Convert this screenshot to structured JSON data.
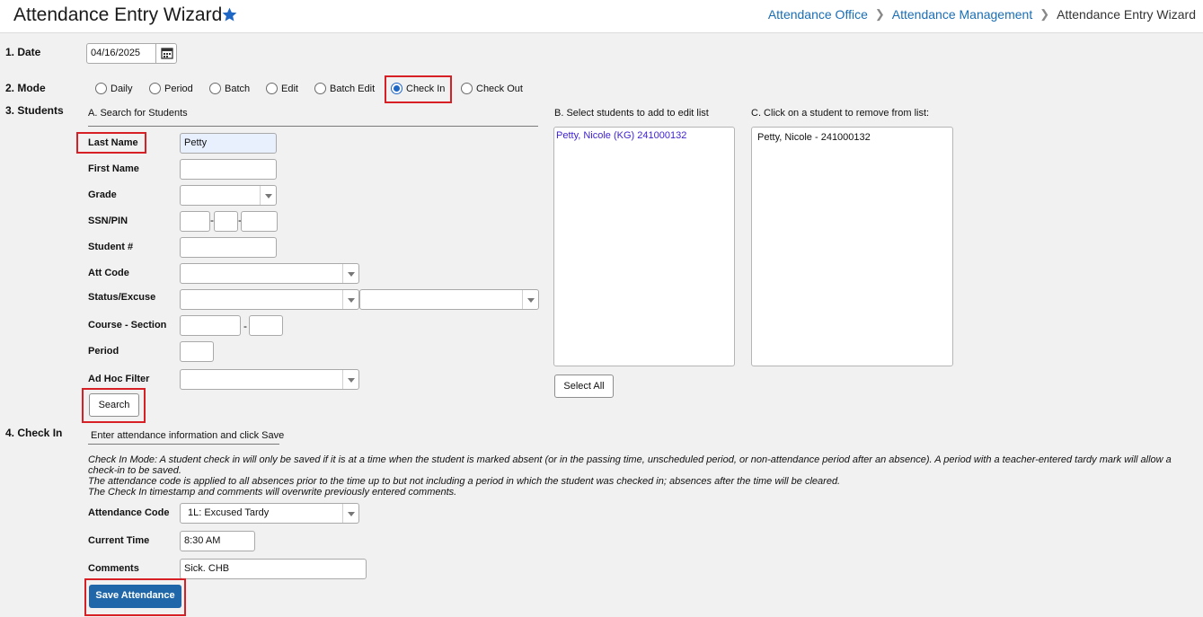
{
  "header": {
    "title": "Attendance Entry Wizard",
    "breadcrumb": [
      "Attendance Office",
      "Attendance Management",
      "Attendance Entry Wizard"
    ]
  },
  "date": {
    "label": "1. Date",
    "value": "04/16/2025"
  },
  "mode": {
    "label": "2. Mode",
    "options": [
      "Daily",
      "Period",
      "Batch",
      "Edit",
      "Batch Edit",
      "Check In",
      "Check Out"
    ],
    "selected": "Check In"
  },
  "students": {
    "label": "3. Students",
    "search": {
      "heading": "A. Search for Students",
      "last_name_label": "Last Name",
      "last_name_value": "Petty",
      "first_name_label": "First Name",
      "grade_label": "Grade",
      "ssn_label": "SSN/PIN",
      "student_num_label": "Student #",
      "att_code_label": "Att Code",
      "status_excuse_label": "Status/Excuse",
      "course_section_label": "Course - Section",
      "period_label": "Period",
      "adhoc_label": "Ad Hoc Filter",
      "search_button": "Search",
      "dash": "-"
    },
    "select": {
      "heading": "B. Select students to add to edit list",
      "items": [
        "Petty, Nicole (KG) 241000132"
      ],
      "select_all_button": "Select All"
    },
    "remove": {
      "heading": "C. Click on a student to remove from list:",
      "items": [
        "Petty, Nicole - 241000132"
      ]
    }
  },
  "checkin": {
    "label": "4. Check In",
    "heading": "Enter attendance information and click Save",
    "instructions": [
      "Check In Mode: A student check in will only be saved if it is at a time when the student is marked absent (or in the passing time, unscheduled period, or non-attendance period after an absence). A period with a teacher-entered tardy mark will allow a check-in to be saved.",
      "The attendance code is applied to all absences prior to the time up to but not including a period in which the student was checked in; absences after the time will be cleared.",
      "The Check In timestamp and comments will overwrite previously entered comments."
    ],
    "attendance_code_label": "Attendance Code",
    "attendance_code_value": "1L: Excused Tardy",
    "current_time_label": "Current Time",
    "current_time_value": "8:30 AM",
    "comments_label": "Comments",
    "comments_value": "Sick. CHB",
    "save_button": "Save Attendance"
  },
  "colors": {
    "accent": "#1f67a8",
    "link": "#1a6eb5",
    "highlight": "#d71f26",
    "student_link": "#3b1fd1"
  }
}
